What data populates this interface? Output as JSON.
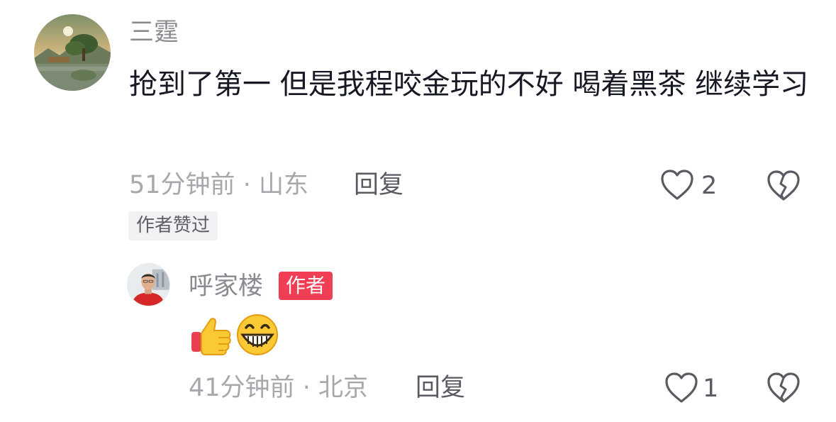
{
  "comment": {
    "username": "三霆",
    "text": "抢到了第一 但是我程咬金玩的不好 喝着黑茶 继续学习",
    "time": "51分钟前",
    "separator": "·",
    "location": "山东",
    "reply_label": "回复",
    "like_count": "2",
    "author_liked_tag": "作者赞过",
    "like_icon": "heart-outline-icon",
    "dislike_icon": "broken-heart-icon"
  },
  "reply": {
    "username": "呼家楼",
    "author_badge": "作者",
    "emojis": [
      "thumbs-up-icon",
      "grinning-face-icon"
    ],
    "time": "41分钟前",
    "separator": "·",
    "location": "北京",
    "reply_label": "回复",
    "like_count": "1",
    "like_icon": "heart-outline-icon",
    "dislike_icon": "broken-heart-icon"
  },
  "colors": {
    "badge": "#f03e55",
    "text": "#161823",
    "muted": "#a7a8ac",
    "icon": "#5a5b62"
  }
}
